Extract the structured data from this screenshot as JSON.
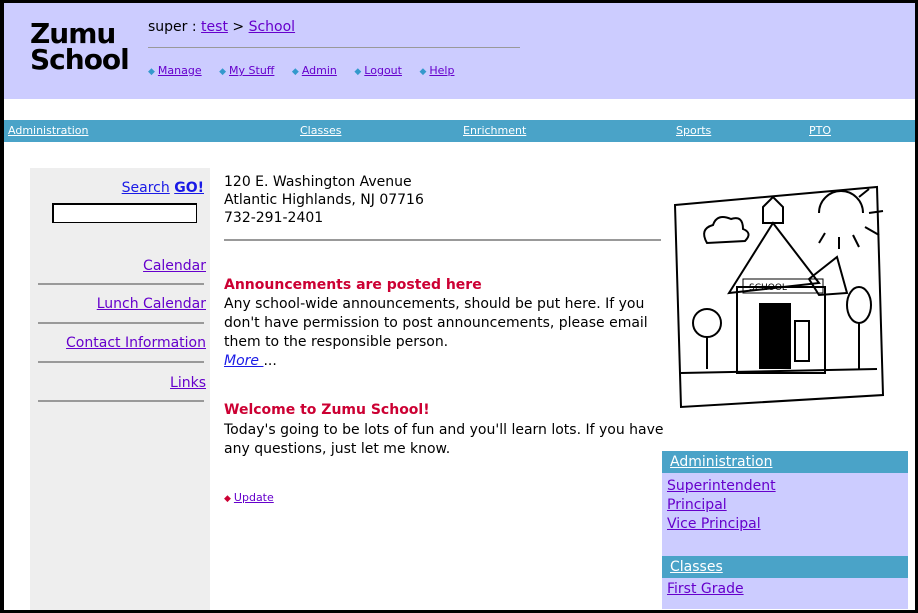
{
  "logo": {
    "line1": "Zumu",
    "line2": "School"
  },
  "breadcrumb": {
    "prefix": "super : ",
    "test_link": "test",
    "sep": " > ",
    "school_link": "School"
  },
  "topnav": [
    "Manage",
    "My Stuff",
    "Admin",
    "Logout",
    "Help"
  ],
  "navbar": [
    "Administration",
    "Classes",
    "Enrichment",
    "Sports",
    "PTO"
  ],
  "sidebar": {
    "search_label": "Search",
    "go_label": "GO!",
    "search_value": "",
    "links": [
      "Calendar",
      "Lunch Calendar",
      "Contact Information",
      "Links"
    ]
  },
  "address": {
    "line1": "120 E. Washington Avenue",
    "line2": "Atlantic Highlands, NJ 07716",
    "phone": "732-291-2401"
  },
  "announcements": [
    {
      "title": "Announcements are posted here",
      "body": "Any school-wide announcements, should be put here. If you don't have permission to post announcements, please email them to the responsible person.",
      "more": "More ",
      "ellipsis": "..."
    },
    {
      "title": "Welcome to Zumu School!",
      "body": "Today's going to be lots of fun and you'll learn lots. If you have any questions, just let me know."
    }
  ],
  "update_label": "Update",
  "image_text": "SCHOOL",
  "rightpanel": [
    {
      "heading": "Administration",
      "items": [
        "Superintendent",
        "Principal",
        "Vice Principal"
      ]
    },
    {
      "heading": "Classes",
      "items": [
        "First Grade"
      ]
    }
  ],
  "colors": {
    "header": "#ccccff",
    "navbar": "#4aa3c8",
    "announce_title": "#cc0033",
    "link": "#6600cc"
  }
}
